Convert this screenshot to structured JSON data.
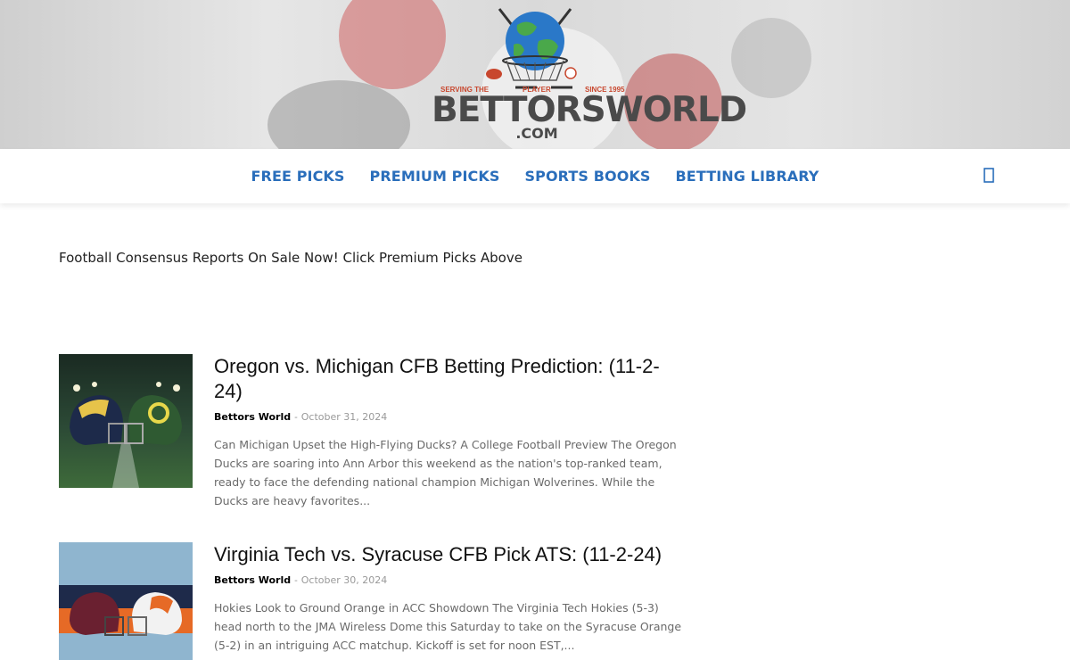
{
  "header": {
    "logo_name": "BETTORSWORLD",
    "logo_suffix": ".COM",
    "strap_left": "SERVING THE",
    "strap_mid": "PLAYER",
    "strap_right": "SINCE 1995"
  },
  "nav": {
    "items": [
      {
        "label": "FREE PICKS"
      },
      {
        "label": "PREMIUM PICKS"
      },
      {
        "label": "SPORTS BOOKS"
      },
      {
        "label": "BETTING LIBRARY"
      }
    ],
    "search_icon": "search-icon",
    "link_color": "#2a6ebb"
  },
  "notice": {
    "text": "Football Consensus Reports On Sale Now! Click Premium Picks Above"
  },
  "posts": [
    {
      "title": "Oregon vs. Michigan CFB Betting Prediction: (11-2-24)",
      "author": "Bettors World",
      "separator": "-",
      "date": "October 31, 2024",
      "excerpt": "Can Michigan Upset the High-Flying Ducks? A College Football Preview The Oregon Ducks are soaring into Ann Arbor this weekend as the nation's top-ranked team, ready to face the defending national champion Michigan Wolverines. While the Ducks are heavy favorites..."
    },
    {
      "title": "Virginia Tech vs. Syracuse CFB Pick ATS: (11-2-24)",
      "author": "Bettors World",
      "separator": "-",
      "date": "October 30, 2024",
      "excerpt": "Hokies Look to Ground Orange in ACC Showdown The Virginia Tech Hokies (5-3) head north to the JMA Wireless Dome this Saturday to take on the Syracuse Orange (5-2) in an intriguing ACC matchup. Kickoff is set for noon EST,..."
    }
  ]
}
